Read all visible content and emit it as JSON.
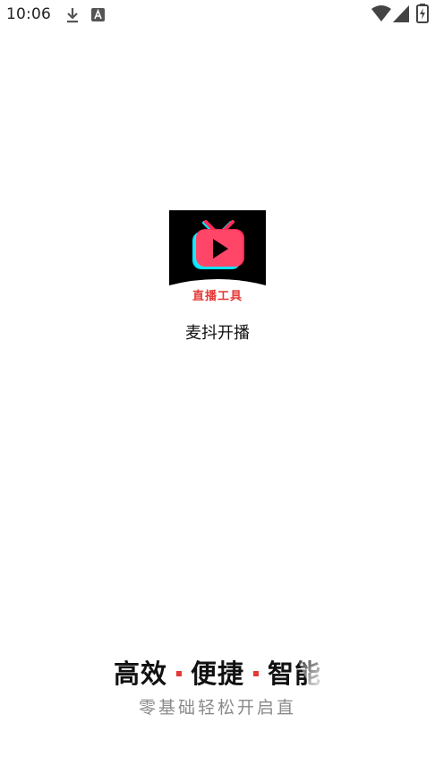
{
  "status_bar": {
    "time": "10:06",
    "icons": [
      "download-icon",
      "a-notification-icon",
      "wifi-icon",
      "signal-icon",
      "battery-icon"
    ]
  },
  "app": {
    "name": "麦抖开播",
    "logo_text": "直播工具",
    "logo_icon": "tv-play-icon"
  },
  "slogan": {
    "part1": "高效",
    "part2": "便捷",
    "part3": "智能",
    "subtitle": "零基础轻松开启直"
  },
  "colors": {
    "background": "#ffffff",
    "logo_background": "#000000",
    "accent_red": "#e53935",
    "accent_cyan": "#00e5ff",
    "accent_pink": "#ff2d55"
  }
}
